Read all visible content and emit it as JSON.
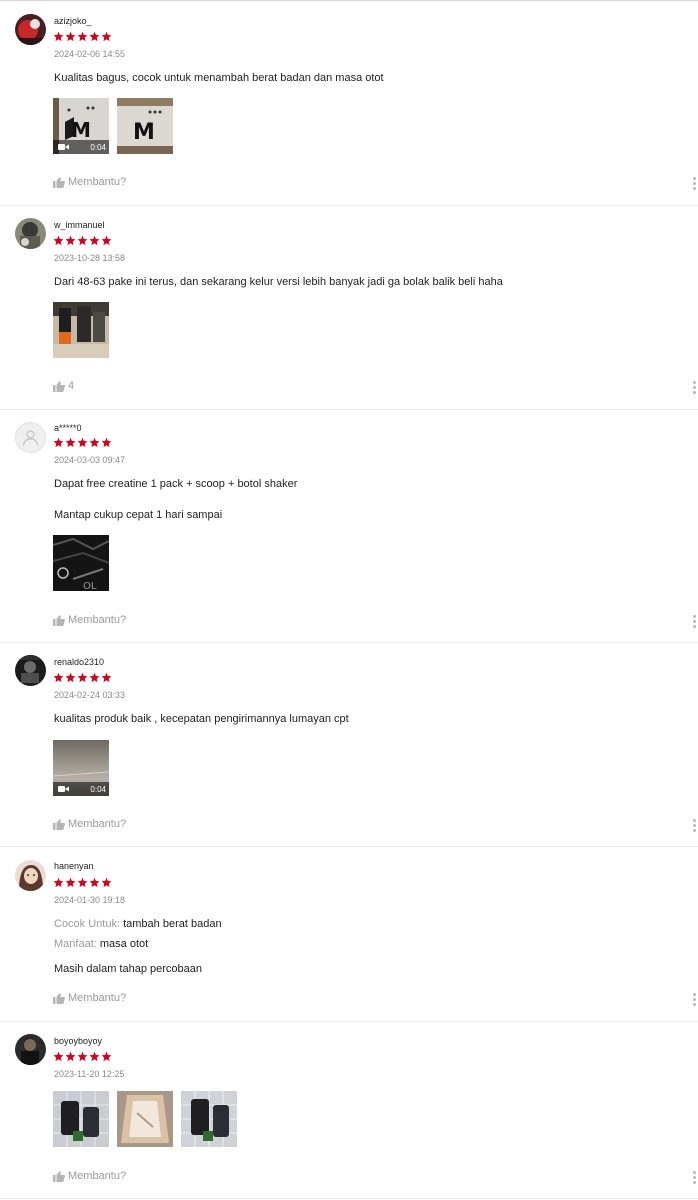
{
  "theme": {
    "star_color": "#d0011b",
    "muted_text": "#8a8a8a"
  },
  "reviews": [
    {
      "username": "azizjoko_",
      "rating": 5,
      "date": "2024-02-06 14:55",
      "body": [
        "Kualitas bagus, cocok untuk menambah berat badan dan masa otot"
      ],
      "media": [
        {
          "type": "video",
          "duration": "0:04",
          "description": "box with M logo"
        },
        {
          "type": "image",
          "description": "box with M logo"
        }
      ],
      "helpful_label": "Membantu?"
    },
    {
      "username": "w_immanuel",
      "rating": 5,
      "date": "2023-10-28 13:58",
      "body": [
        "Dari 48-63 pake ini terus, dan sekarang kelur versi lebih banyak jadi ga bolak balik beli haha"
      ],
      "media": [
        {
          "type": "image",
          "description": "product bottles on desk"
        }
      ],
      "helpful_label": "4"
    },
    {
      "username": "a*****0",
      "rating": 5,
      "date": "2024-03-03 09:47",
      "body": [
        "Dapat free creatine 1 pack + scoop + botol shaker",
        "Mantap cukup cepat 1 hari sampai"
      ],
      "media": [
        {
          "type": "image",
          "description": "black product package"
        }
      ],
      "helpful_label": "Membantu?"
    },
    {
      "username": "renaldo2310",
      "rating": 5,
      "date": "2024-02-24 03:33",
      "body": [
        "kualitas produk baik , kecepatan pengirimannya lumayan cpt"
      ],
      "media": [
        {
          "type": "video",
          "duration": "0:04",
          "description": "room wall"
        }
      ],
      "helpful_label": "Membantu?"
    },
    {
      "username": "hanenyan",
      "rating": 5,
      "date": "2024-01-30 19:18",
      "attributes": [
        {
          "label": "Cocok Untuk:",
          "value": "tambah berat badan"
        },
        {
          "label": "Manfaat:",
          "value": "masa otot"
        }
      ],
      "body": [
        "Masih dalam tahap percobaan"
      ],
      "media": [],
      "helpful_label": "Membantu?"
    },
    {
      "username": "boyoyboyoy",
      "rating": 5,
      "date": "2023-11-20 12:25",
      "body": [],
      "media": [
        {
          "type": "image",
          "description": "product jars on tiles"
        },
        {
          "type": "image",
          "description": "open paper bag"
        },
        {
          "type": "image",
          "description": "product jars on tiles"
        }
      ],
      "helpful_label": "Membantu?"
    }
  ]
}
